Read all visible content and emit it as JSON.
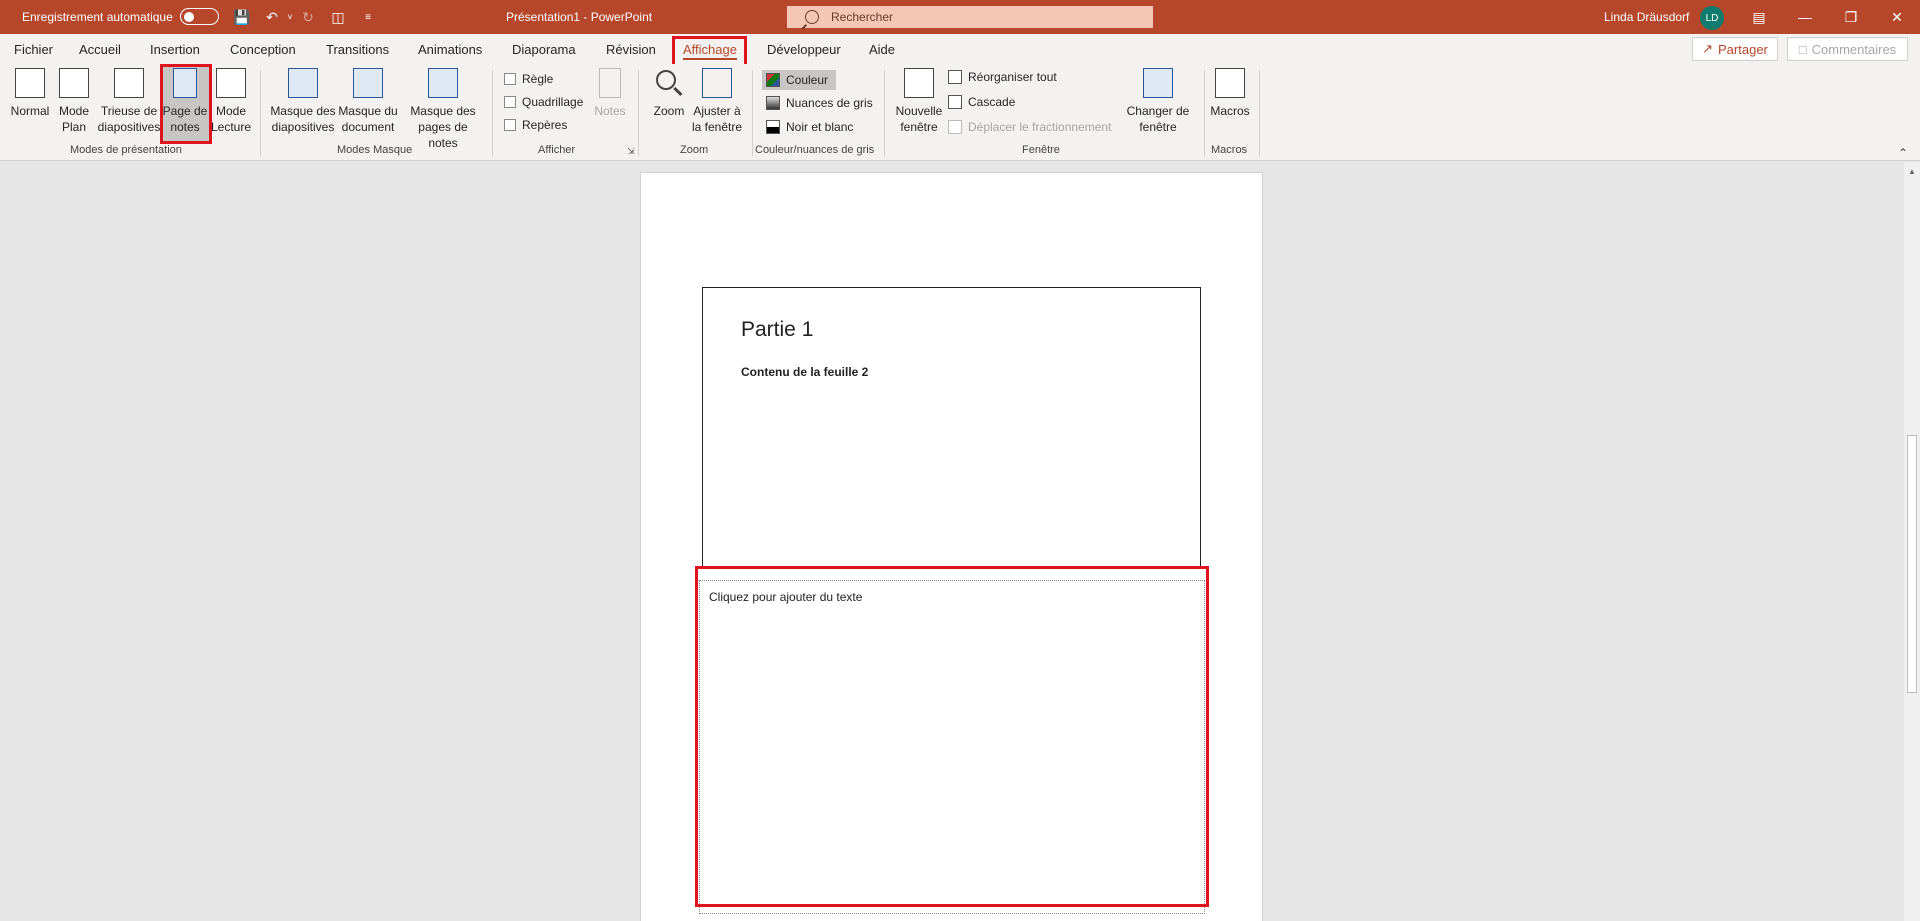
{
  "titlebar": {
    "autosave_label": "Enregistrement automatique",
    "doc_title": "Présentation1  -  PowerPoint",
    "search_placeholder": "Rechercher",
    "user_name": "Linda Dräusdorf",
    "avatar_initials": "LD",
    "brand_color": "#b7472a"
  },
  "tabs": [
    "Fichier",
    "Accueil",
    "Insertion",
    "Conception",
    "Transitions",
    "Animations",
    "Diaporama",
    "Révision",
    "Affichage",
    "Développeur",
    "Aide"
  ],
  "active_tab": "Affichage",
  "share_label": "Partager",
  "comments_label": "Commentaires",
  "ribbon": {
    "modes_presentation": {
      "label": "Modes de présentation",
      "normal": "Normal",
      "plan_1": "Mode",
      "plan_2": "Plan",
      "trieuse_1": "Trieuse de",
      "trieuse_2": "diapositives",
      "notes_1": "Page de",
      "notes_2": "notes",
      "lecture_1": "Mode",
      "lecture_2": "Lecture"
    },
    "modes_masque": {
      "label": "Modes Masque",
      "diapo_1": "Masque des",
      "diapo_2": "diapositives",
      "doc_1": "Masque du",
      "doc_2": "document",
      "notes_1": "Masque des",
      "notes_2": "pages de notes"
    },
    "afficher": {
      "label": "Afficher",
      "regle": "Règle",
      "quadrillage": "Quadrillage",
      "reperes": "Repères",
      "notes": "Notes"
    },
    "zoom": {
      "label": "Zoom",
      "zoom": "Zoom",
      "fit_1": "Ajuster à",
      "fit_2": "la fenêtre"
    },
    "couleur": {
      "label": "Couleur/nuances de gris",
      "couleur": "Couleur",
      "gris": "Nuances de gris",
      "noir": "Noir et blanc"
    },
    "fenetre": {
      "label": "Fenêtre",
      "nouvelle_1": "Nouvelle",
      "nouvelle_2": "fenêtre",
      "reorganiser": "Réorganiser tout",
      "cascade": "Cascade",
      "deplacer": "Déplacer le fractionnement",
      "changer_1": "Changer de",
      "changer_2": "fenêtre"
    },
    "macros": {
      "label": "Macros",
      "macros": "Macros"
    }
  },
  "notes_page": {
    "slide_title": "Partie 1",
    "slide_body": "Contenu de la feuille 2",
    "notes_placeholder": "Cliquez pour ajouter du texte"
  }
}
